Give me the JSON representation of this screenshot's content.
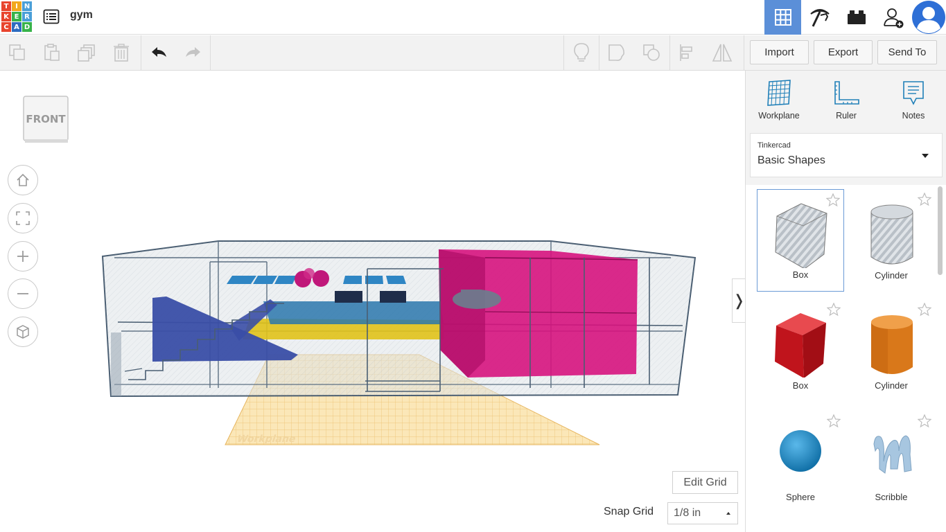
{
  "logo": {
    "letters": [
      "T",
      "I",
      "N",
      "K",
      "E",
      "R",
      "C",
      "A",
      "D"
    ]
  },
  "project": {
    "name": "gym"
  },
  "toolbar": {
    "import_label": "Import",
    "export_label": "Export",
    "send_to_label": "Send To"
  },
  "viewport": {
    "viewcube_label": "FRONT",
    "workplane_label": "Workplane",
    "edit_grid_label": "Edit Grid",
    "snap_grid_label": "Snap Grid",
    "snap_grid_value": "1/8 in",
    "collapse_glyph": "❭"
  },
  "panel": {
    "tools": [
      {
        "label": "Workplane",
        "icon": "workplane-icon"
      },
      {
        "label": "Ruler",
        "icon": "ruler-icon"
      },
      {
        "label": "Notes",
        "icon": "notes-icon"
      }
    ],
    "library": {
      "provider": "Tinkercad",
      "name": "Basic Shapes"
    },
    "shapes": [
      {
        "label": "Box",
        "kind": "box-hole",
        "selected": true
      },
      {
        "label": "Cylinder",
        "kind": "cylinder-hole",
        "selected": false
      },
      {
        "label": "Box",
        "kind": "box-solid",
        "color": "#d5212a",
        "selected": false
      },
      {
        "label": "Cylinder",
        "kind": "cylinder-solid",
        "color": "#e98a1c",
        "selected": false
      },
      {
        "label": "Sphere",
        "kind": "sphere",
        "color": "#1e90c8",
        "selected": false
      },
      {
        "label": "Scribble",
        "kind": "scribble",
        "color": "#a8c7e0",
        "selected": false
      }
    ]
  },
  "colors": {
    "accent": "#5b8fd8",
    "logo": [
      "#e8442e",
      "#f2a81d",
      "#4a9fd8",
      "#e8442e",
      "#37b34a",
      "#4a9fd8",
      "#e8442e",
      "#2d6cc0",
      "#37b34a"
    ]
  }
}
